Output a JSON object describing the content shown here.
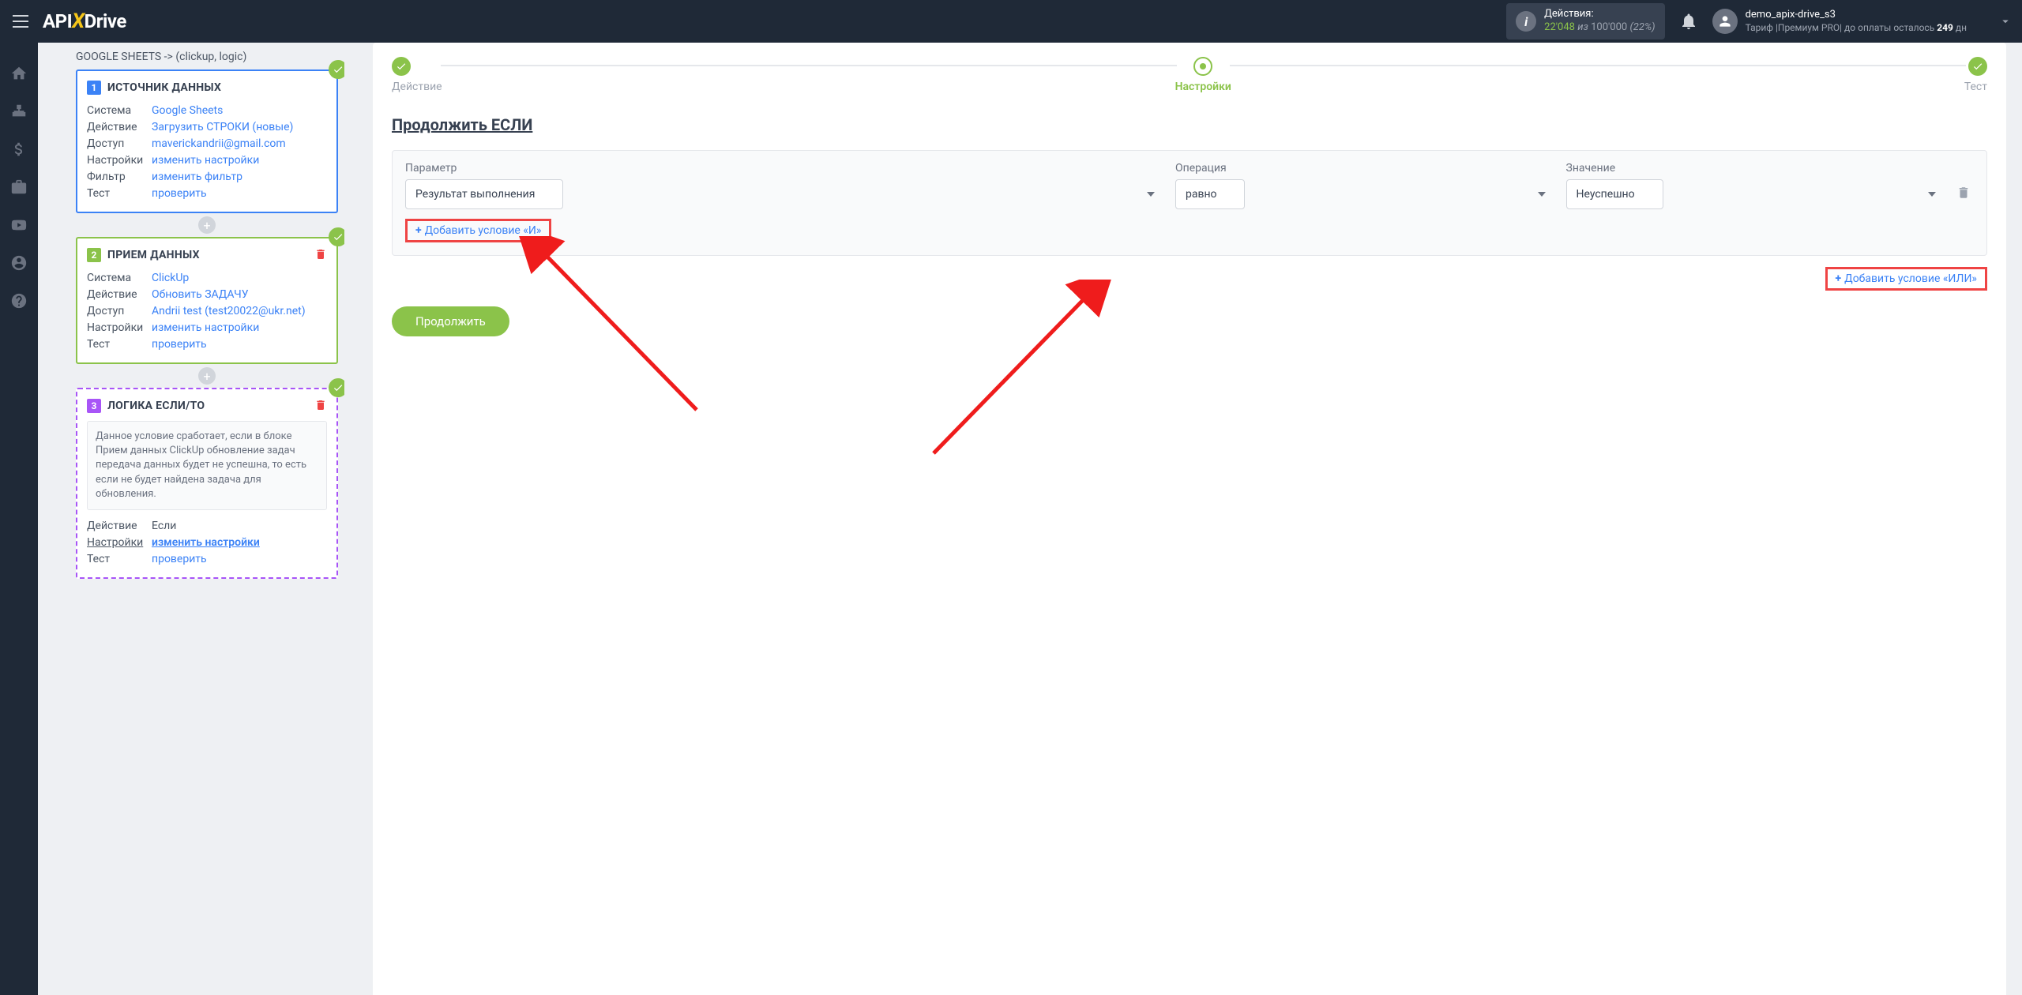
{
  "header": {
    "logo": {
      "api": "API",
      "x": "X",
      "drive": "Drive"
    },
    "actions": {
      "label": "Действия:",
      "used": "22'048",
      "sep": "из",
      "total": "100'000",
      "pct": "(22%)"
    },
    "user": {
      "name": "demo_apix-drive_s3",
      "plan_prefix": "Тариф |Премиум PRO| до оплаты осталось ",
      "days": "249",
      "days_sfx": " дн"
    }
  },
  "flow": {
    "title": "GOOGLE SHEETS -> (clickup, logic)",
    "block1": {
      "num": "1",
      "title": "ИСТОЧНИК ДАННЫХ",
      "rows": {
        "system_l": "Система",
        "system_v": "Google Sheets",
        "action_l": "Действие",
        "action_v": "Загрузить СТРОКИ (новые)",
        "access_l": "Доступ",
        "access_v": "maverickandrii@gmail.com",
        "settings_l": "Настройки",
        "settings_v": "изменить настройки",
        "filter_l": "Фильтр",
        "filter_v": "изменить фильтр",
        "test_l": "Тест",
        "test_v": "проверить"
      }
    },
    "block2": {
      "num": "2",
      "title": "ПРИЕМ ДАННЫХ",
      "rows": {
        "system_l": "Система",
        "system_v": "ClickUp",
        "action_l": "Действие",
        "action_v": "Обновить ЗАДАЧУ",
        "access_l": "Доступ",
        "access_v": "Andrii test (test20022@ukr.net)",
        "settings_l": "Настройки",
        "settings_v": "изменить настройки",
        "test_l": "Тест",
        "test_v": "проверить"
      }
    },
    "block3": {
      "num": "3",
      "title": "ЛОГИКА ЕСЛИ/ТО",
      "desc": "Данное условие сработает, если в блоке Прием данных ClickUp обновление задач передача данных будет не успешна, то есть если не будет найдена задача для обновления.",
      "rows": {
        "action_l": "Действие",
        "action_v": "Если",
        "settings_l": "Настройки",
        "settings_v": "изменить настройки",
        "test_l": "Тест",
        "test_v": "проверить"
      }
    }
  },
  "steps": {
    "s1": "Действие",
    "s2": "Настройки",
    "s3": "Тест"
  },
  "main": {
    "title": "Продолжить ЕСЛИ",
    "labels": {
      "param": "Параметр",
      "op": "Операция",
      "val": "Значение"
    },
    "values": {
      "param": "Результат выполнения",
      "op": "равно",
      "val": "Неуспешно"
    },
    "add_and": "Добавить условие «И»",
    "add_or": "Добавить условие «ИЛИ»",
    "continue": "Продолжить"
  }
}
